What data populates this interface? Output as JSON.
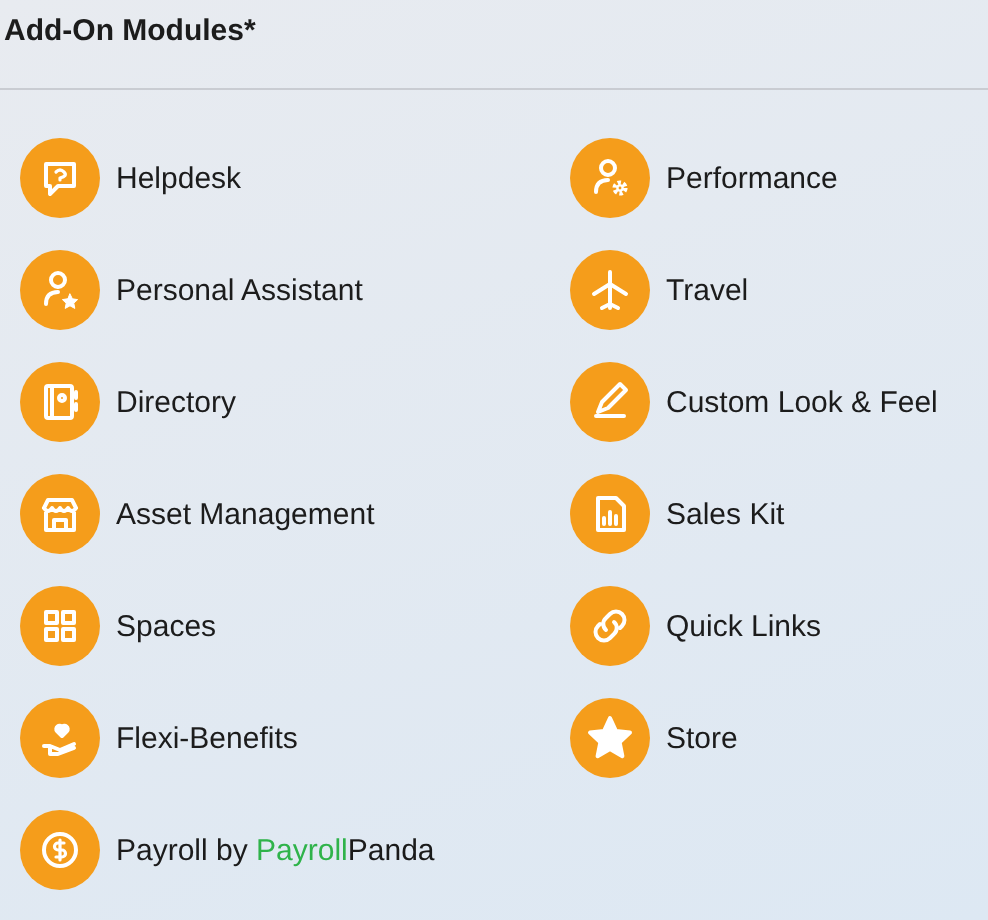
{
  "title": "Add-On Modules*",
  "modules": [
    {
      "label": "Helpdesk"
    },
    {
      "label": "Performance"
    },
    {
      "label": "Personal Assistant"
    },
    {
      "label": "Travel"
    },
    {
      "label": "Directory"
    },
    {
      "label": "Custom Look & Feel"
    },
    {
      "label": "Asset Management"
    },
    {
      "label": "Sales Kit"
    },
    {
      "label": "Spaces"
    },
    {
      "label": "Quick Links"
    },
    {
      "label": "Flexi-Benefits"
    },
    {
      "label": "Store"
    },
    {
      "label": "Payroll by",
      "brand": [
        {
          "text": "Payroll",
          "color": "#2fb34a"
        },
        {
          "text": "Panda",
          "color": "#1a1a1a"
        }
      ]
    }
  ]
}
